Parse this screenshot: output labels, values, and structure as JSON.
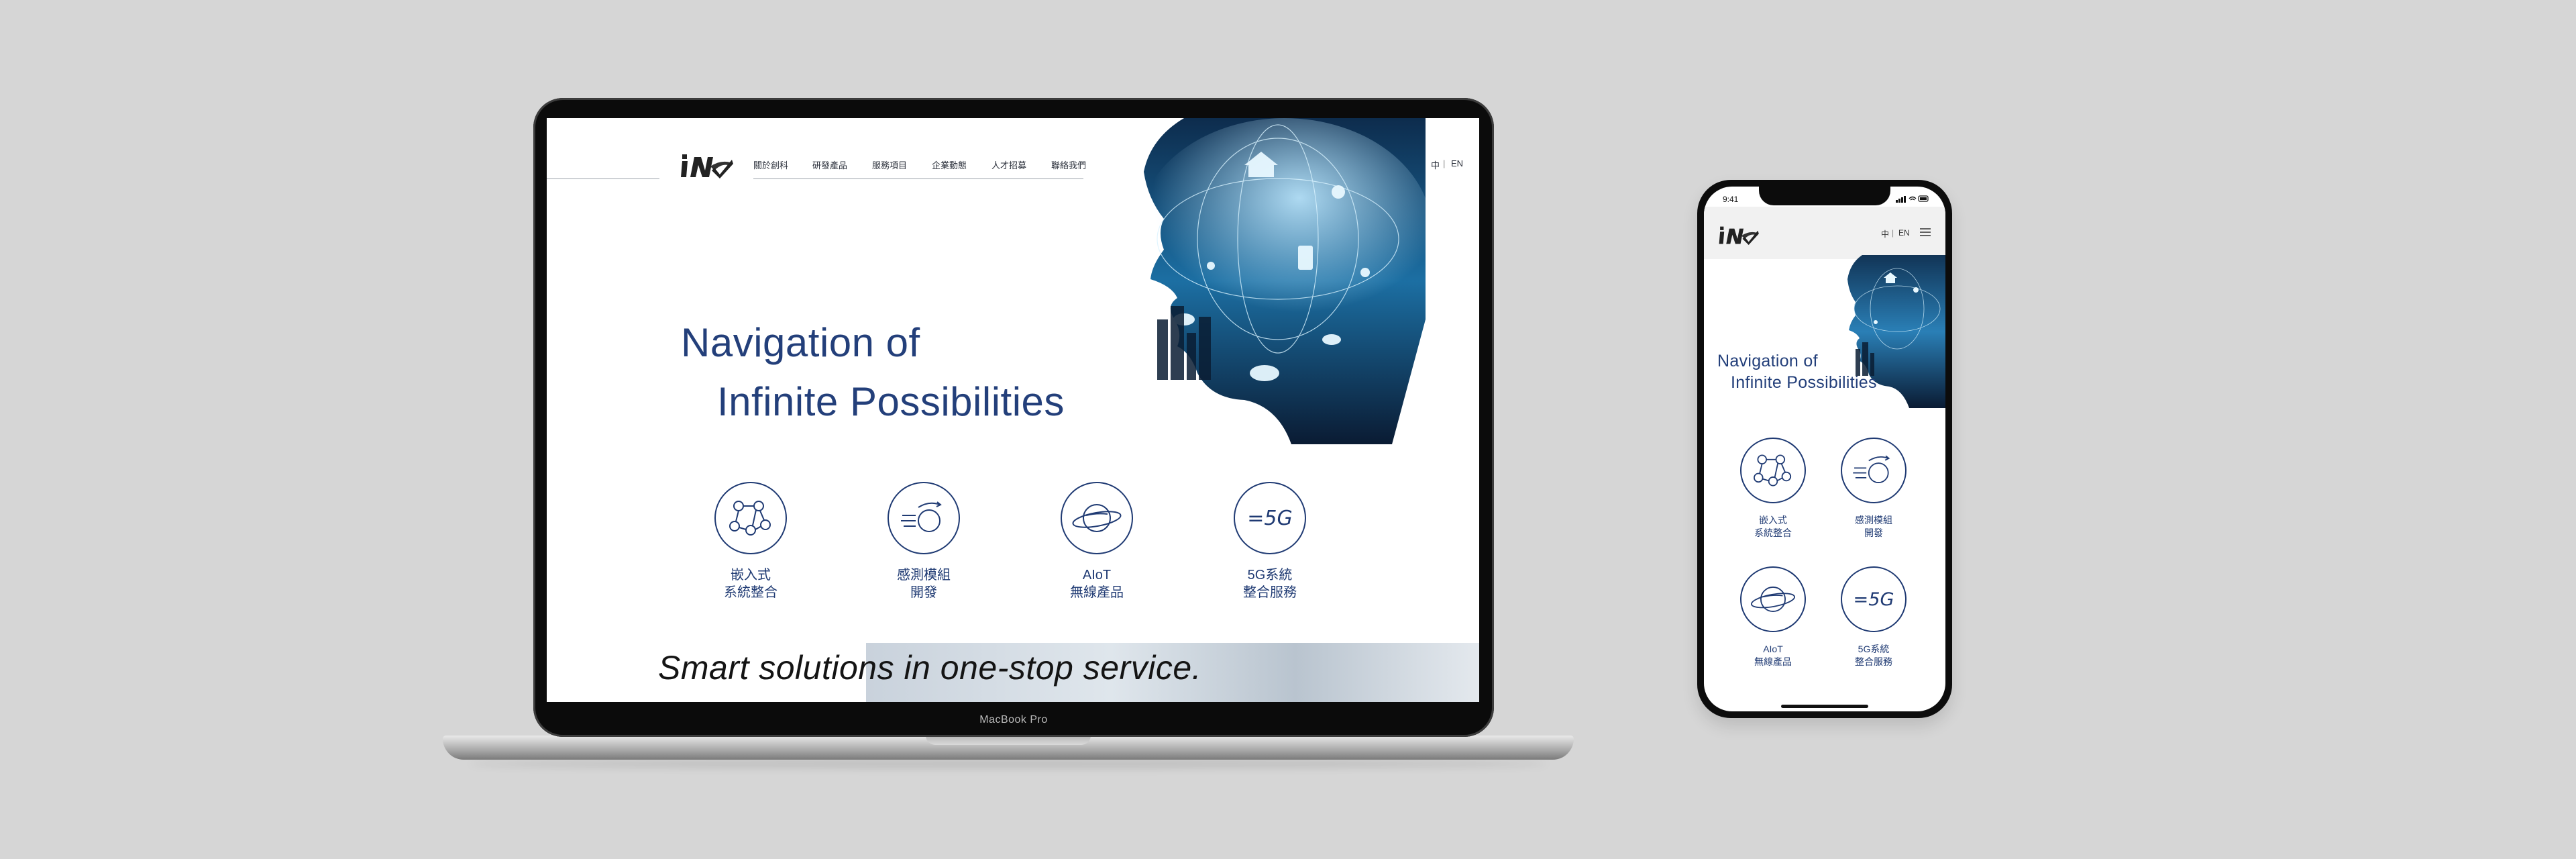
{
  "laptop": {
    "brand_label": "MacBook Pro"
  },
  "desktop_site": {
    "nav": [
      "關於創科",
      "研發產品",
      "服務項目",
      "企業動態",
      "人才招募",
      "聯絡我們"
    ],
    "lang": {
      "zh": "中",
      "sep": "|",
      "en": "EN"
    },
    "hero": {
      "line1": "Navigation of",
      "line2": "Infinite Possibilities"
    },
    "services": [
      {
        "line1": "嵌入式",
        "line2": "系統整合",
        "icon": "network-nodes-icon"
      },
      {
        "line1": "感測模組",
        "line2": "開發",
        "icon": "sensor-motion-icon"
      },
      {
        "line1": "AIoT",
        "line2": "無線產品",
        "icon": "planet-orbit-icon"
      },
      {
        "line1": "5G系統",
        "line2": "整合服務",
        "icon": "5g-icon"
      }
    ],
    "icon_5g_text": "=5G",
    "banner_text": "Smart solutions in one-stop service."
  },
  "phone_site": {
    "status_time": "9:41",
    "lang": {
      "zh": "中",
      "sep": "|",
      "en": "EN"
    },
    "hero": {
      "line1": "Navigation of",
      "line2": "Infinite Possibilities"
    },
    "services": [
      {
        "line1": "嵌入式",
        "line2": "系統整合",
        "icon": "network-nodes-icon"
      },
      {
        "line1": "感測模組",
        "line2": "開發",
        "icon": "sensor-motion-icon"
      },
      {
        "line1": "AIoT",
        "line2": "無線產品",
        "icon": "planet-orbit-icon"
      },
      {
        "line1": "5G系統",
        "line2": "整合服務",
        "icon": "5g-icon"
      }
    ],
    "icon_5g_text": "=5G"
  },
  "colors": {
    "brand_blue": "#1f3a73",
    "hero_blue": "#233f7a",
    "background": "#d6d6d6"
  }
}
